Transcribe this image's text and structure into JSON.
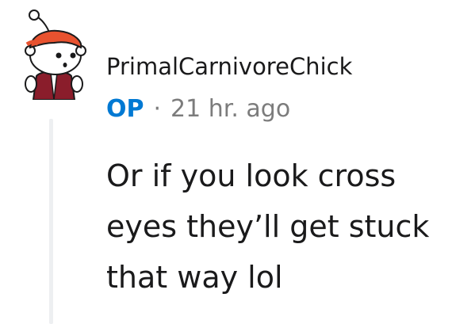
{
  "comment": {
    "username": "PrimalCarnivoreChick",
    "op_badge": "OP",
    "separator": "·",
    "timestamp": "21 hr. ago",
    "body_lines": [
      "Or if you look cross",
      "eyes they’ll get stuck",
      "that way lol"
    ],
    "avatar_icon": "snoo-avatar-icon"
  },
  "colors": {
    "op_accent": "#0079d3",
    "meta_gray": "#7c7c7c",
    "text": "#1a1a1b",
    "thread_line": "#edeff1",
    "avatar_hat": "#e8522f",
    "avatar_jacket": "#8a1d2b"
  }
}
